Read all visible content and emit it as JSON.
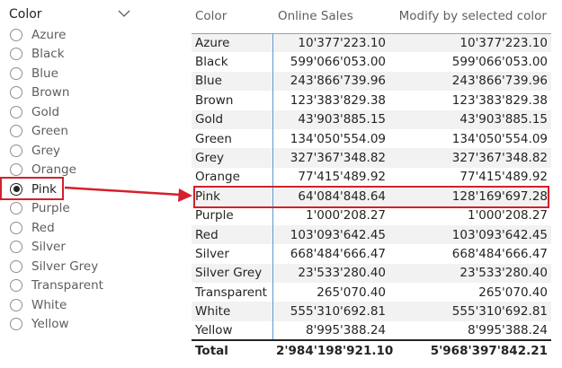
{
  "slicer": {
    "title": "Color",
    "options": [
      "Azure",
      "Black",
      "Blue",
      "Brown",
      "Gold",
      "Green",
      "Grey",
      "Orange",
      "Pink",
      "Purple",
      "Red",
      "Silver",
      "Silver Grey",
      "Transparent",
      "White",
      "Yellow"
    ],
    "selected": "Pink"
  },
  "table": {
    "headers": [
      "Color",
      "Online Sales",
      "Modify by selected color"
    ],
    "rows": [
      [
        "Azure",
        "10'377'223.10",
        "10'377'223.10"
      ],
      [
        "Black",
        "599'066'053.00",
        "599'066'053.00"
      ],
      [
        "Blue",
        "243'866'739.96",
        "243'866'739.96"
      ],
      [
        "Brown",
        "123'383'829.38",
        "123'383'829.38"
      ],
      [
        "Gold",
        "43'903'885.15",
        "43'903'885.15"
      ],
      [
        "Green",
        "134'050'554.09",
        "134'050'554.09"
      ],
      [
        "Grey",
        "327'367'348.82",
        "327'367'348.82"
      ],
      [
        "Orange",
        "77'415'489.92",
        "77'415'489.92"
      ],
      [
        "Pink",
        "64'084'848.64",
        "128'169'697.28"
      ],
      [
        "Purple",
        "1'000'208.27",
        "1'000'208.27"
      ],
      [
        "Red",
        "103'093'642.45",
        "103'093'642.45"
      ],
      [
        "Silver",
        "668'484'666.47",
        "668'484'666.47"
      ],
      [
        "Silver Grey",
        "23'533'280.40",
        "23'533'280.40"
      ],
      [
        "Transparent",
        "265'070.40",
        "265'070.40"
      ],
      [
        "White",
        "555'310'692.81",
        "555'310'692.81"
      ],
      [
        "Yellow",
        "8'995'388.24",
        "8'995'388.24"
      ]
    ],
    "total": [
      "Total",
      "2'984'198'921.10",
      "5'968'397'842.21"
    ]
  },
  "icons": {
    "dropdown": "chevron-down-icon"
  },
  "colors": {
    "highlight": "#d5202b",
    "divider": "#5b9bd5",
    "stripe": "#f2f2f2"
  }
}
